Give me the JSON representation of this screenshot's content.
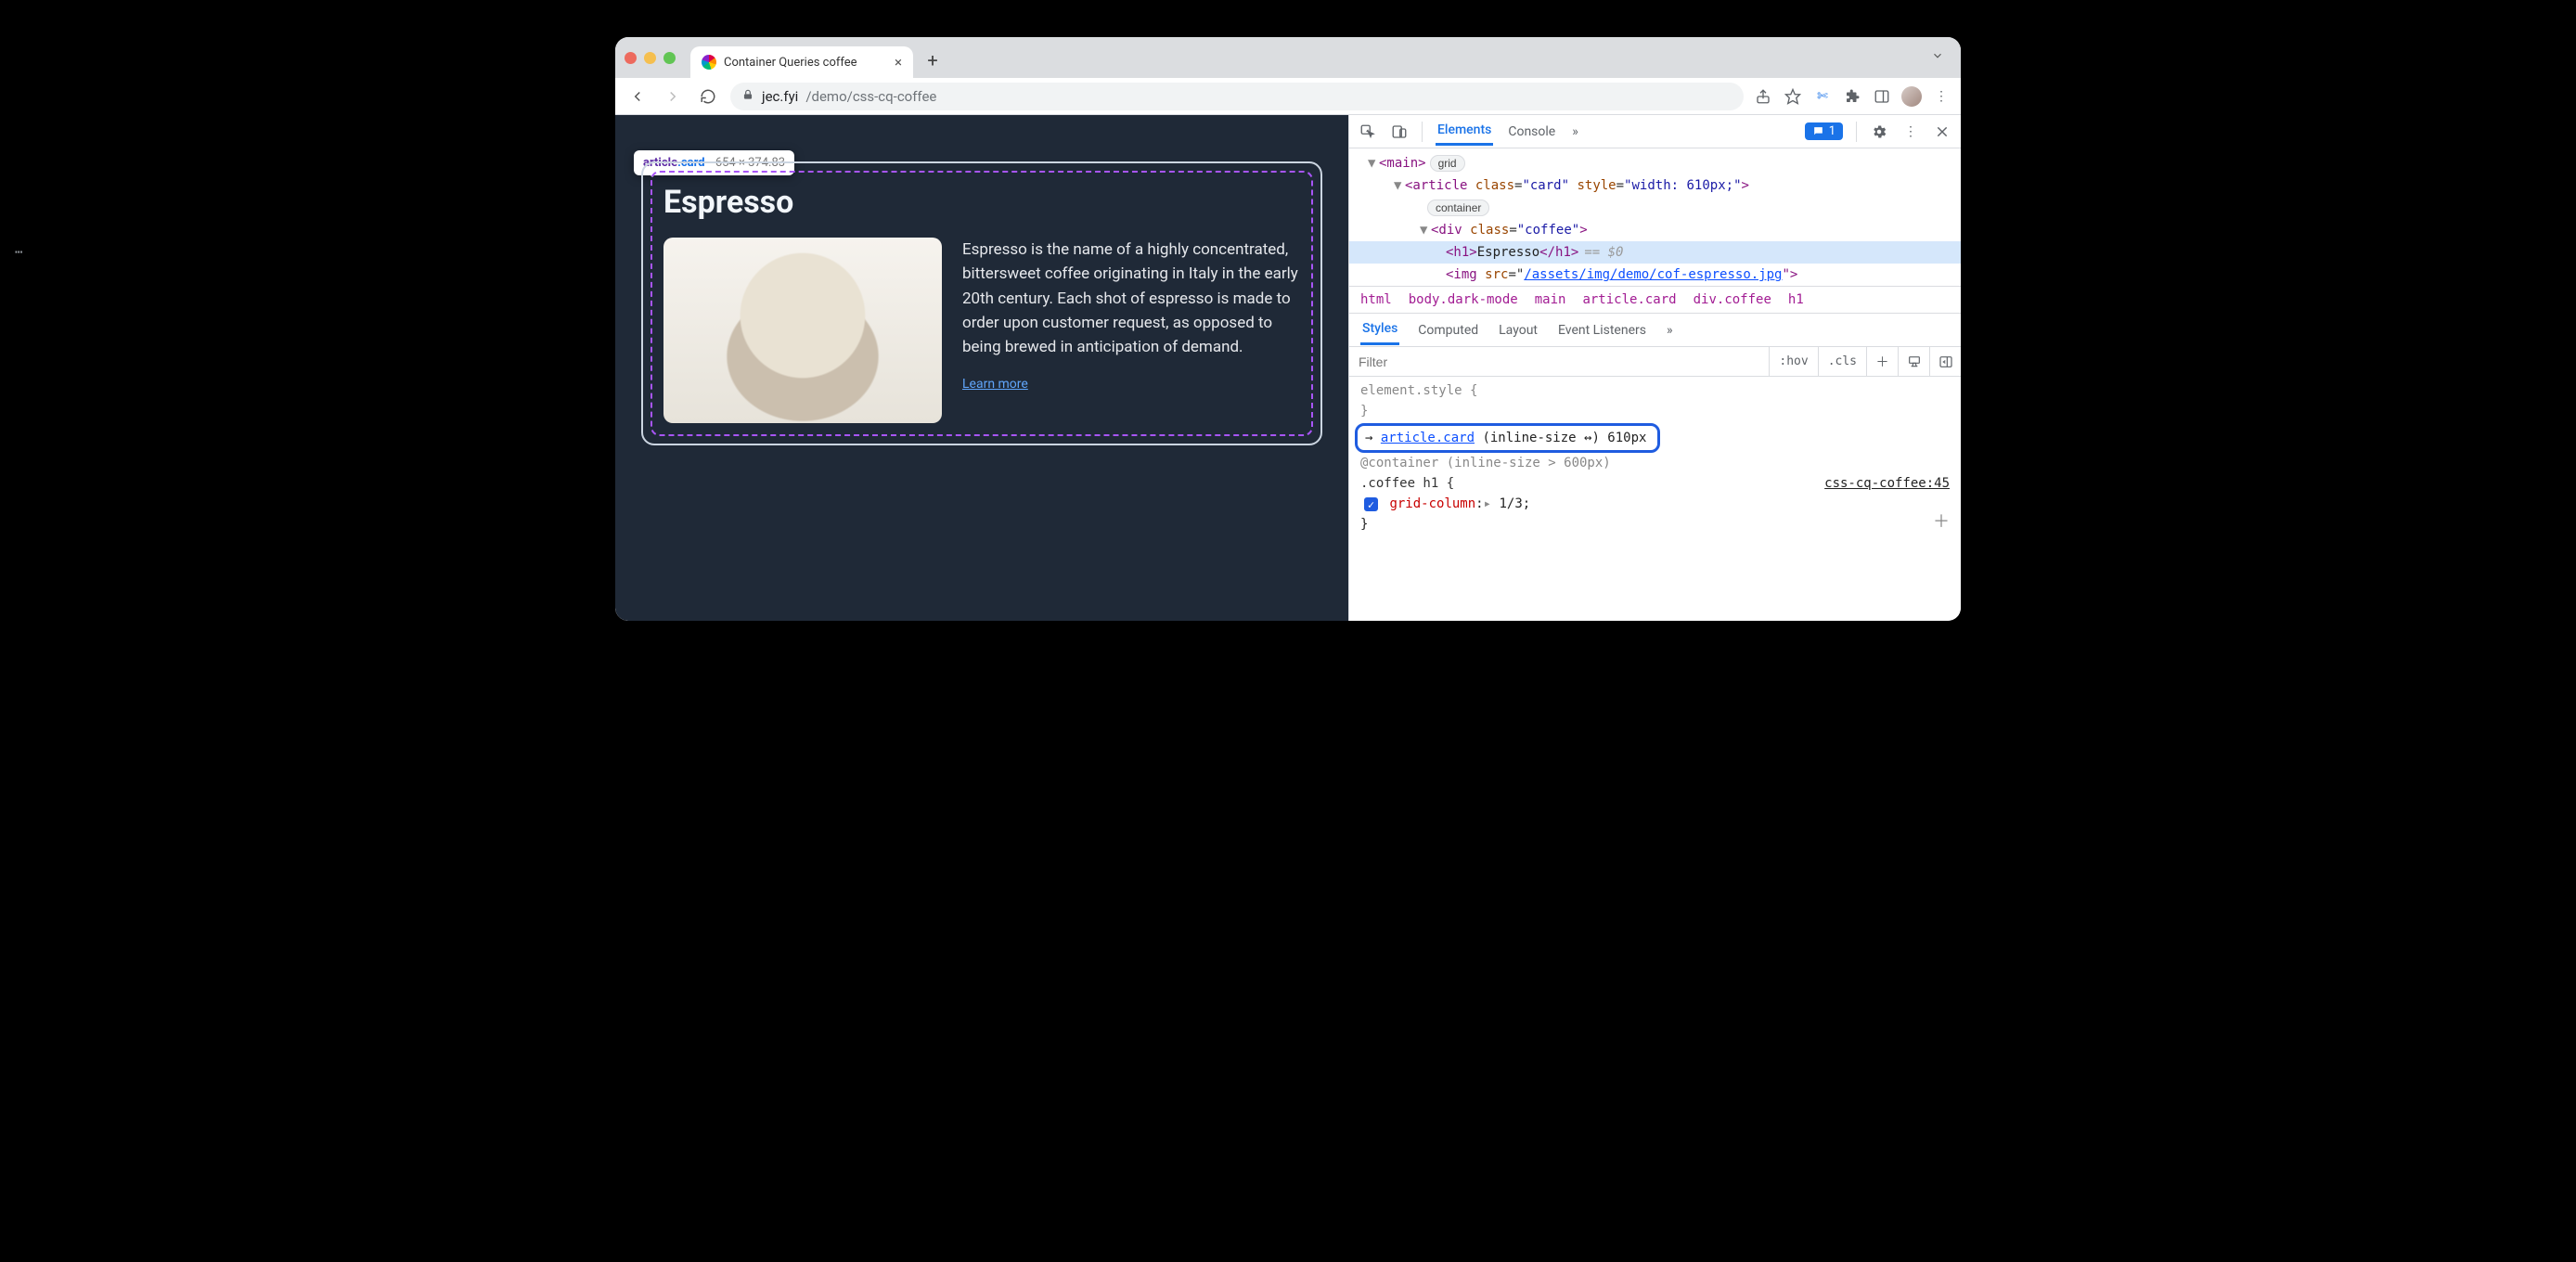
{
  "chrome": {
    "tab_title": "Container Queries coffee",
    "newtab_label": "+",
    "url_host": "jec.fyi",
    "url_path": "/demo/css-cq-coffee",
    "menu_dots": "⋮"
  },
  "page": {
    "hover_tag": "article",
    "hover_class": ".card",
    "hover_dims": "654 × 374.83",
    "title": "Espresso",
    "desc": "Espresso is the name of a highly concentrated, bittersweet coffee originating in Italy in the early 20th century. Each shot of espresso is made to order upon customer request, as opposed to being brewed in anticipation of demand.",
    "learn_more": "Learn more"
  },
  "devtools": {
    "tabs": {
      "elements": "Elements",
      "console": "Console",
      "more": "»"
    },
    "issue_count": "1",
    "dom": {
      "main_open": "<main>",
      "grid_pill": "grid",
      "article_open_1": "<article ",
      "article_attr_class": "class",
      "article_val_class": "\"card\"",
      "article_attr_style": "style",
      "article_val_style": "\"width: 610px;\"",
      "article_close": ">",
      "container_pill": "container",
      "div_open_1": "<div ",
      "div_attr_class": "class",
      "div_val_class": "\"coffee\"",
      "div_close": ">",
      "h1_open": "<h1>",
      "h1_text": "Espresso",
      "h1_end": "</h1>",
      "eq_sel": "== $0",
      "img_open": "<img ",
      "img_attr": "src",
      "img_eq": "=\"",
      "img_href": "/assets/img/demo/cof-espresso.jpg",
      "img_end": "\">"
    },
    "breadcrumb": [
      "html",
      "body.dark-mode",
      "main",
      "article.card",
      "div.coffee",
      "h1"
    ],
    "styles_tabs": {
      "styles": "Styles",
      "computed": "Computed",
      "layout": "Layout",
      "listeners": "Event Listeners",
      "more": "»"
    },
    "filter_placeholder": "Filter",
    "filter_hov": ":hov",
    "filter_cls": ".cls",
    "element_style": "element.style {",
    "brace_close": "}",
    "cq_prefix": "→ ",
    "cq_selector": "article.card",
    "cq_paren": " (inline-size ↔) 610px",
    "at_container": "@container (inline-size > 600px)",
    "rule_selector": ".coffee h1 {",
    "rule_src": "css-cq-coffee:45",
    "rule_prop": "grid-column",
    "rule_val": "1/3",
    "rule_arrow": "▸",
    "rule_semi": ";",
    "rule_end": "}"
  }
}
